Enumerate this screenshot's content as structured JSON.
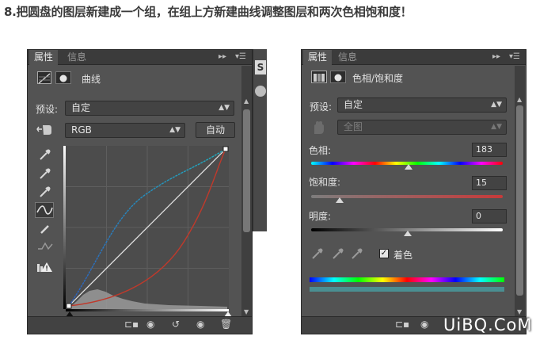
{
  "heading": "8.把圆盘的图层新建成一个组，在组上方新建曲线调整图层和两次色相饱和度！",
  "curves_panel": {
    "tabs": [
      "属性",
      "信息"
    ],
    "tab_controls": "▸▸",
    "menu_icon": "panel-menu-icon",
    "adjustment_name": "曲线",
    "preset_label": "预设:",
    "preset_value": "自定",
    "channel_value": "RGB",
    "auto_button": "自动",
    "tools": [
      "hand-icon",
      "eyedropper-black-icon",
      "eyedropper-gray-icon",
      "eyedropper-white-icon",
      "curve-point-icon",
      "pencil-icon",
      "smooth-icon",
      "clipping-warning-icon"
    ],
    "footer_buttons": [
      "clip-to-layer-icon",
      "view-previous-icon",
      "reset-icon",
      "visibility-icon",
      "trash-icon"
    ]
  },
  "hue_panel": {
    "tabs": [
      "属性",
      "信息"
    ],
    "tab_controls": "▸▸",
    "adjustment_name": "色相/饱和度",
    "preset_label": "预设:",
    "preset_value": "自定",
    "channel_value": "全图",
    "hue_label": "色相:",
    "hue_value": "183",
    "saturation_label": "饱和度:",
    "saturation_value": "15",
    "lightness_label": "明度:",
    "lightness_value": "0",
    "colorize_label": "着色",
    "colorize_checked": true,
    "colors": {
      "result_bar": "#4a8f92",
      "panel_bg": "#535353",
      "tab_bg": "#3b3b3b"
    }
  },
  "middle_strip": {
    "label": "S"
  },
  "watermark": "UiBQ.CoM"
}
